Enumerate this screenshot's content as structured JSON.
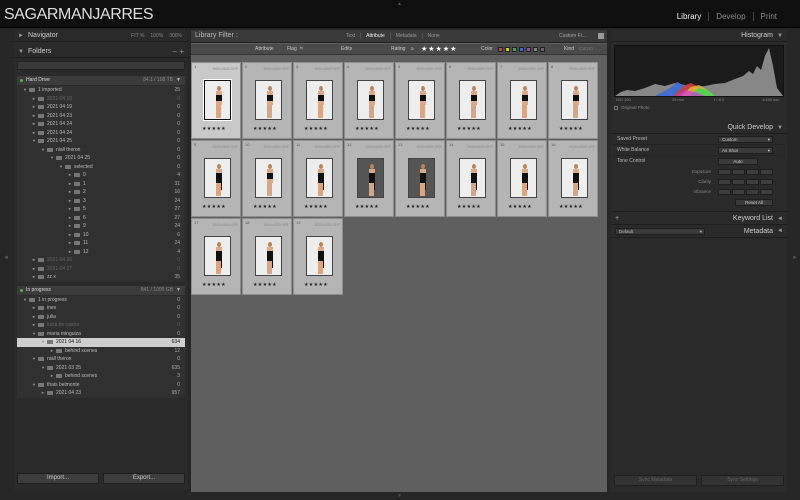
{
  "logo": "SAGARMANJARRES",
  "modules": [
    "Library",
    "Develop",
    "Print"
  ],
  "left": {
    "navigator": {
      "title": "Navigator",
      "zoom": [
        "FIT %",
        "100%",
        "300%"
      ]
    },
    "folders": {
      "title": "Folders",
      "filter_placeholder": ""
    },
    "volumes": [
      {
        "name": "Hard Drive",
        "capacity": "84.1 / 108 TB"
      },
      {
        "name": "In progress",
        "capacity": "841 / 1000 GB"
      }
    ],
    "tree1": [
      {
        "name": "1 imported",
        "count": "25",
        "level": 0,
        "exp": "▼",
        "dim": false
      },
      {
        "name": "2021 04 10",
        "count": "0",
        "level": 1,
        "exp": "►",
        "dim": true
      },
      {
        "name": "2021 04 19",
        "count": "0",
        "level": 1,
        "exp": "►",
        "dim": false
      },
      {
        "name": "2021 04 23",
        "count": "0",
        "level": 1,
        "exp": "►",
        "dim": false
      },
      {
        "name": "2021 04 24",
        "count": "0",
        "level": 1,
        "exp": "►",
        "dim": false
      },
      {
        "name": "2021 04 24",
        "count": "0",
        "level": 1,
        "exp": "►",
        "dim": false
      },
      {
        "name": "2021 04 25",
        "count": "0",
        "level": 1,
        "exp": "▼",
        "dim": false
      },
      {
        "name": "niall theron",
        "count": "0",
        "level": 2,
        "exp": "▼",
        "dim": false
      },
      {
        "name": "2021 04 25",
        "count": "0",
        "level": 3,
        "exp": "▼",
        "dim": false
      },
      {
        "name": "selected",
        "count": "0",
        "level": 4,
        "exp": "▼",
        "dim": false
      },
      {
        "name": "0",
        "count": "4",
        "level": 5,
        "exp": "►",
        "dim": false
      },
      {
        "name": "1",
        "count": "31",
        "level": 5,
        "exp": "►",
        "dim": false
      },
      {
        "name": "2",
        "count": "16",
        "level": 5,
        "exp": "►",
        "dim": false
      },
      {
        "name": "3",
        "count": "24",
        "level": 5,
        "exp": "►",
        "dim": false
      },
      {
        "name": "5",
        "count": "27",
        "level": 5,
        "exp": "►",
        "dim": false
      },
      {
        "name": "6",
        "count": "27",
        "level": 5,
        "exp": "►",
        "dim": false
      },
      {
        "name": "9",
        "count": "24",
        "level": 5,
        "exp": "►",
        "dim": false
      },
      {
        "name": "10",
        "count": "6",
        "level": 5,
        "exp": "►",
        "dim": false
      },
      {
        "name": "11",
        "count": "24",
        "level": 5,
        "exp": "►",
        "dim": false
      },
      {
        "name": "12",
        "count": "4",
        "level": 5,
        "exp": "►",
        "dim": false
      },
      {
        "name": "2021 04 26",
        "count": "0",
        "level": 1,
        "exp": "►",
        "dim": true
      },
      {
        "name": "2021 04 27",
        "count": "0",
        "level": 1,
        "exp": "►",
        "dim": true
      },
      {
        "name": "zz x",
        "count": "35",
        "level": 1,
        "exp": "►",
        "dim": false
      }
    ],
    "tree2": [
      {
        "name": "1 in progress",
        "count": "0",
        "level": 0,
        "exp": "▼",
        "dim": false,
        "sel": false
      },
      {
        "name": "ines",
        "count": "0",
        "level": 1,
        "exp": "►",
        "dim": false,
        "sel": false
      },
      {
        "name": "julia",
        "count": "0",
        "level": 1,
        "exp": "►",
        "dim": false,
        "sel": false
      },
      {
        "name": "lucia de castro",
        "count": "0",
        "level": 1,
        "exp": "►",
        "dim": true,
        "sel": false
      },
      {
        "name": "maria minguiza",
        "count": "0",
        "level": 1,
        "exp": "▼",
        "dim": false,
        "sel": false
      },
      {
        "name": "2021 04 16",
        "count": "634",
        "level": 2,
        "exp": "▼",
        "dim": false,
        "sel": true
      },
      {
        "name": "behind scenes",
        "count": "12",
        "level": 3,
        "exp": "►",
        "dim": false,
        "sel": false
      },
      {
        "name": "niall theron",
        "count": "0",
        "level": 1,
        "exp": "▼",
        "dim": false,
        "sel": false
      },
      {
        "name": "2021 03 25",
        "count": "635",
        "level": 2,
        "exp": "▼",
        "dim": false,
        "sel": false
      },
      {
        "name": "behind scenes",
        "count": "3",
        "level": 3,
        "exp": "►",
        "dim": false,
        "sel": false
      },
      {
        "name": "thais belmonte",
        "count": "0",
        "level": 1,
        "exp": "▼",
        "dim": false,
        "sel": false
      },
      {
        "name": "2021 04 23",
        "count": "957",
        "level": 2,
        "exp": "►",
        "dim": false,
        "sel": false
      }
    ],
    "buttons": {
      "import": "Import...",
      "export": "Export..."
    }
  },
  "center": {
    "filter_title": "Library Filter :",
    "tabs": [
      "Text",
      "Attribute",
      "Metadata",
      "None"
    ],
    "preset": "Custom Fi...",
    "attr": {
      "attribute": "Attribute",
      "flag": "Flag",
      "edits": "Edits",
      "rating": "Rating",
      "rating_op": "≥",
      "stars": "★★★★★",
      "color": "Color",
      "kind": "Kind"
    },
    "swatch_colors": [
      "#c44",
      "#cc4",
      "#4a4",
      "#46c",
      "#a4a",
      "#888",
      "#666"
    ],
    "thumbs": [
      {
        "idx": "1",
        "dim": "3000x4500 ORF",
        "rating": "★★★★★",
        "pose": "bikini",
        "sel": true
      },
      {
        "idx": "2",
        "dim": "3000x4500 ORF",
        "rating": "★★★★★",
        "pose": "bikini",
        "sel": false
      },
      {
        "idx": "3",
        "dim": "3000x4500 ORF",
        "rating": "★★★★★",
        "pose": "bikini",
        "sel": false
      },
      {
        "idx": "4",
        "dim": "3000x4500 ORF",
        "rating": "★★★★★",
        "pose": "bikini",
        "sel": false
      },
      {
        "idx": "5",
        "dim": "3000x4500 ORF",
        "rating": "★★★★★",
        "pose": "bikini",
        "sel": false
      },
      {
        "idx": "6",
        "dim": "3000x4500 ORF",
        "rating": "★★★★★",
        "pose": "bikini",
        "sel": false
      },
      {
        "idx": "7",
        "dim": "3000x4500 ORF",
        "rating": "★★★★★",
        "pose": "bikini",
        "sel": false
      },
      {
        "idx": "8",
        "dim": "3000x4500 ORF",
        "rating": "★★★★★",
        "pose": "bikini",
        "sel": false
      },
      {
        "idx": "9",
        "dim": "3000x4500 ORF",
        "rating": "★★★★★",
        "pose": "dress",
        "sel": false
      },
      {
        "idx": "10",
        "dim": "3000x4500 ORF",
        "rating": "★★★★★",
        "pose": "bikini",
        "sel": false
      },
      {
        "idx": "11",
        "dim": "3000x4500 ORF",
        "rating": "★★★★★",
        "pose": "dress",
        "sel": false
      },
      {
        "idx": "12",
        "dim": "3000x4500 ORF",
        "rating": "★★★★★",
        "pose": "dress",
        "sel": false
      },
      {
        "idx": "13",
        "dim": "3000x4500 ORF",
        "rating": "★★★★★",
        "pose": "dress",
        "sel": false
      },
      {
        "idx": "14",
        "dim": "3000x4500 ORF",
        "rating": "★★★★★",
        "pose": "dress",
        "sel": false
      },
      {
        "idx": "15",
        "dim": "3000x4500 ORF",
        "rating": "★★★★★",
        "pose": "dress",
        "sel": false
      },
      {
        "idx": "16",
        "dim": "3000x4500 ORF",
        "rating": "★★★★★",
        "pose": "dress",
        "sel": false
      },
      {
        "idx": "17",
        "dim": "3000x4500 ORF",
        "rating": "★★★★★",
        "pose": "dress",
        "sel": false
      },
      {
        "idx": "18",
        "dim": "3000x4500 ORF",
        "rating": "★★★★★",
        "pose": "dress",
        "sel": false
      },
      {
        "idx": "19",
        "dim": "3000x4500 ORF",
        "rating": "★★★★★",
        "pose": "dress",
        "sel": false
      }
    ]
  },
  "right": {
    "histogram": {
      "title": "Histogram",
      "info": [
        "ISO 100",
        "35 mm",
        "f / 8.0",
        "1/160 sec"
      ],
      "original_photo": "Original Photo"
    },
    "quick_develop": {
      "title": "Quick Develop",
      "saved_preset_label": "Saved Preset",
      "saved_preset_value": "Custom",
      "white_balance_label": "White Balance",
      "white_balance_value": "As Shot",
      "tone_control_label": "Tone Control",
      "auto": "Auto",
      "exposure": "Exposure",
      "clarity": "Clarity",
      "vibrance": "Vibrance",
      "reset_all": "Reset All"
    },
    "keyword_list": "Keyword List",
    "metadata": {
      "title": "Metadata",
      "preset": "Default"
    },
    "buttons": {
      "sync_metadata": "Sync Metadata",
      "sync_settings": "Sync Settings"
    }
  }
}
